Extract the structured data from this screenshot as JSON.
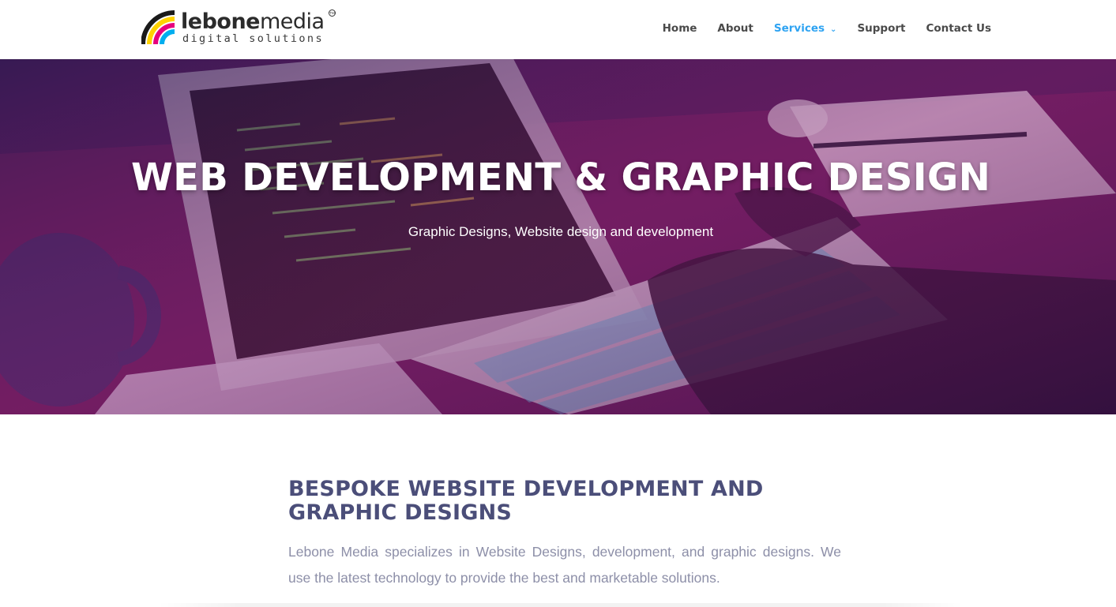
{
  "brand": {
    "name_bold": "lebone",
    "name_regular": "media",
    "tagline": "digital solutions",
    "trademark": "TM",
    "colors": [
      "#1a1a1a",
      "#e6007e",
      "#ffd200",
      "#00aeef"
    ]
  },
  "nav": {
    "items": [
      {
        "label": "Home"
      },
      {
        "label": "About"
      },
      {
        "label": "Services",
        "active": true,
        "dropdown_icon": "chevron-down-icon"
      },
      {
        "label": "Support"
      },
      {
        "label": "Contact Us"
      }
    ],
    "accent": "#2ea3f2"
  },
  "hero": {
    "title": "WEB DEVELOPMENT & GRAPHIC DESIGN",
    "subtitle": "Graphic Designs, Website design and development"
  },
  "intro": {
    "title": "BESPOKE WEBSITE DEVELOPMENT AND GRAPHIC DESIGNS",
    "body": "Lebone Media specializes in Website Designs, development, and graphic designs. We use the latest technology to provide the best and marketable solutions.",
    "title_color": "#4b4e79",
    "body_color": "#8d8fa8"
  }
}
